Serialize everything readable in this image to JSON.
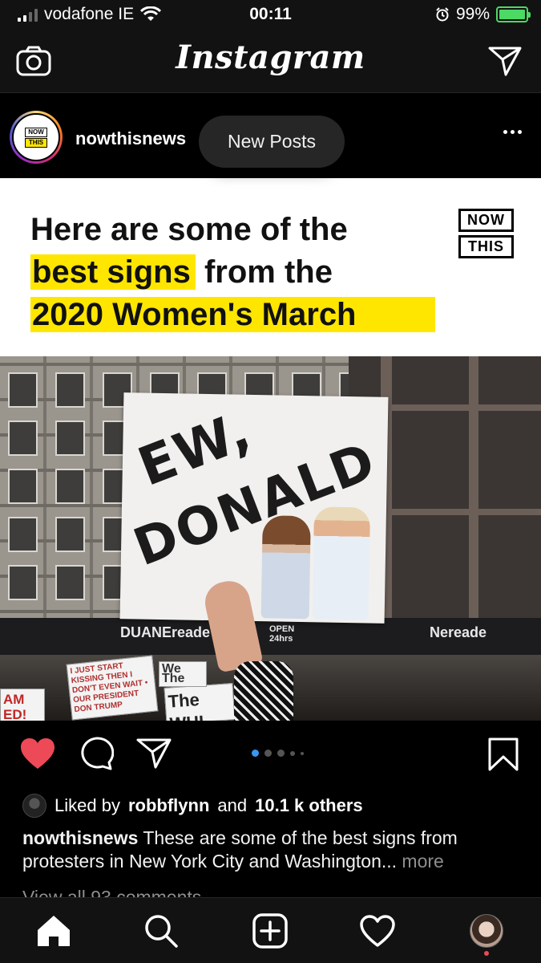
{
  "status_bar": {
    "carrier": "vodafone IE",
    "time": "00:11",
    "battery_percent": "99%",
    "battery_level": 0.99,
    "icons": [
      "signal-icon",
      "wifi-icon",
      "alarm-icon",
      "battery-charging-icon"
    ]
  },
  "header": {
    "title": "Instagram",
    "icons": [
      "camera-icon",
      "direct-message-icon"
    ]
  },
  "post": {
    "username": "nowthisnews",
    "new_posts_label": "New Posts",
    "avatar_logo": {
      "top": "NOW",
      "bottom": "THIS"
    },
    "banner": {
      "line1": "Here are some of the",
      "line2_highlight": "best signs",
      "line2_rest": " from the",
      "line3_highlight": "2020 Women's March",
      "logo_top": "NOW",
      "logo_bottom": "THIS",
      "highlight_color": "#ffe600"
    },
    "photo": {
      "sign_line1": "EW,",
      "sign_line2": "DONALD",
      "store_name": "DUANEreade",
      "store_name_right": "Nereade",
      "store_hours": "OPEN 24hrs",
      "small_sign_1": "I JUST START KISSING THEN I DON'T EVEN WAIT • OUR PRESIDENT DON TRUMP",
      "small_sign_2": "The WHI",
      "small_sign_3": "We The",
      "small_sign_4": "AM ED!"
    },
    "carousel": {
      "count": 5,
      "active_index": 0
    },
    "likes": {
      "prefix": "Liked by",
      "user": "robbflynn",
      "connector": "and",
      "others": "10.1 k others"
    },
    "caption": {
      "user": "nowthisnews",
      "text": " These are some of the best signs from protesters in New York City and Washington...",
      "more": " more"
    },
    "comments_link": "View all 93 comments",
    "liked": true
  },
  "bottom_nav": {
    "items": [
      "home-icon",
      "search-icon",
      "new-post-icon",
      "activity-icon",
      "profile-avatar"
    ],
    "active": "home-icon"
  },
  "colors": {
    "like_red": "#ed4956",
    "accent_blue": "#3897f0",
    "battery_green": "#4cd964"
  }
}
